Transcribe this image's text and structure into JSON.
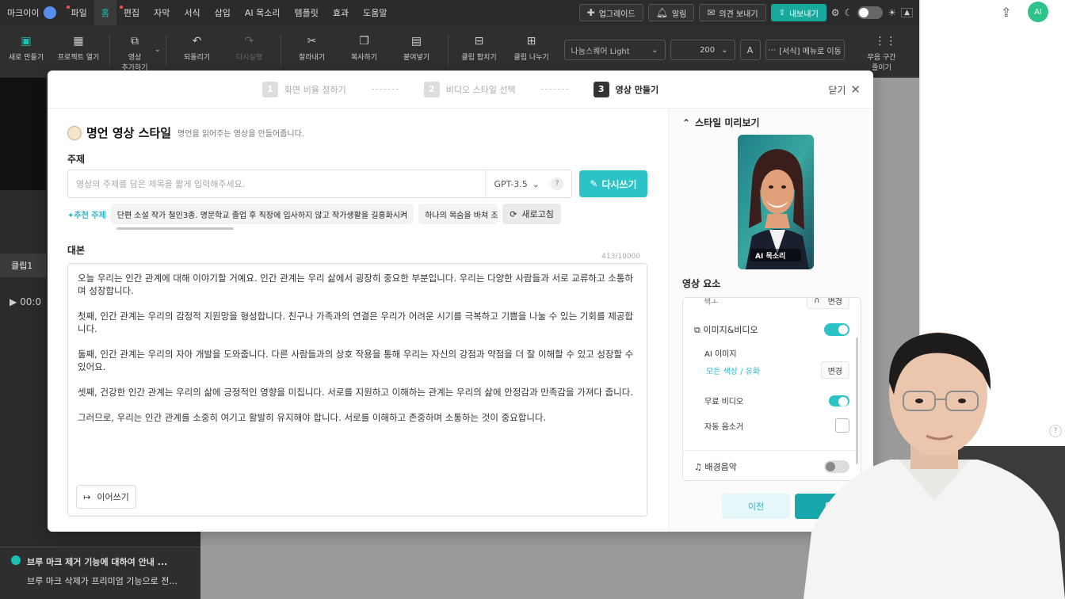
{
  "menubar": {
    "user": "마크이이",
    "items": [
      {
        "label": "파일",
        "dot": true
      },
      {
        "label": "홈",
        "active": true
      },
      {
        "label": "편집",
        "dot": true
      },
      {
        "label": "자막"
      },
      {
        "label": "서식"
      },
      {
        "label": "삽입"
      },
      {
        "label": "AI 목소리"
      },
      {
        "label": "템플릿"
      },
      {
        "label": "효과"
      },
      {
        "label": "도움말"
      }
    ],
    "upgrade": "업그레이드",
    "alert": "알림",
    "feedback": "의견 보내기",
    "export": "내보내기"
  },
  "toolbar": {
    "new": "새로 만들기",
    "open": "프로젝트 열기",
    "add_video_1": "영상",
    "add_video_2": "추가하기",
    "undo": "되돌리기",
    "redo": "다시실행",
    "cut": "잘라내기",
    "copy": "복사하기",
    "paste": "붙여넣기",
    "merge": "클립 합치기",
    "split": "클립 나누기",
    "font": "나눔스퀘어 Light",
    "size": "200",
    "format_btn": "A",
    "move_menu": "[서식] 메뉴로 이동",
    "silence_1": "무음 구간",
    "silence_2": "줄이기"
  },
  "leftpanel": {
    "time": "00:0",
    "clip": "클립1",
    "notice_title": "브루 마크 제거 기능에 대하여 안내 ...",
    "notice_body": "브루 마크 삭제가 프리미엄 기능으로 전..."
  },
  "modal": {
    "steps": [
      {
        "num": "1",
        "label": "화면 비율 정하기"
      },
      {
        "num": "2",
        "label": "비디오 스타일 선택"
      },
      {
        "num": "3",
        "label": "영상 만들기",
        "active": true
      }
    ],
    "close": "닫기",
    "style_name": "명언 영상 스타일",
    "style_desc": "명언을 읽어주는 영상을 만들어줍니다.",
    "topic_label": "주제",
    "topic_placeholder": "영상의 주제를 담은 제목을 짧게 입력해주세요.",
    "model": "GPT-3.5",
    "help": "?",
    "rewrite": "다시쓰기",
    "rec_label": "추천 주제",
    "rec_chips": [
      "단편 소설 작가 철인3종. 명문학교 졸업 후 직장에 입사하지 않고 작가생활을 길홍화시켜",
      "하나의 목숨을 바쳐 조"
    ],
    "refresh": "새로고침",
    "script_label": "대본",
    "counter": "413/10000",
    "script": [
      "오늘 우리는 인간 관계에 대해 이야기할 거예요. 인간 관계는 우리 삶에서 굉장히 중요한 부분입니다. 우리는 다양한 사람들과 서로 교류하고 소통하며 성장합니다.",
      "첫째, 인간 관계는 우리의 감정적 지원망을 형성합니다. 친구나 가족과의 연결은 우리가 어려운 시기를 극복하고 기쁨을 나눌 수 있는 기회를 제공합니다.",
      "둘째, 인간 관계는 우리의 자아 개발을 도와줍니다. 다른 사람들과의 상호 작용을 통해 우리는 자신의 강점과 약점을 더 잘 이해할 수 있고 성장할 수 있어요.",
      "셋째, 건강한 인간 관계는 우리의 삶에 긍정적인 영향을 미칩니다. 서로를 지원하고 이해하는 관계는 우리의 삶에 안정감과 만족감을 가져다 줍니다.",
      "그러므로, 우리는 인간 관계를 소중히 여기고 활발히 유지해야 합니다. 서로를 이해하고 존중하며 소통하는 것이 중요합니다."
    ],
    "continue": "이어쓰기",
    "preview_title": "스타일 미리보기",
    "preview_badge": "AI 목소리",
    "elements_title": "영상 요소",
    "partial_left": "색ㅗ",
    "partial_right": "변경",
    "image_video": "이미지&비디오",
    "ai_image": "AI 이미지",
    "ai_image_value": "모든 색상 / 유화",
    "change": "변경",
    "free_video": "무료 비디오",
    "auto_silence": "자동 음소거",
    "bgm": "배경음악",
    "prev": "이전",
    "make": "완"
  },
  "rightpanel": {
    "avatar": "AI",
    "help": "?"
  },
  "colors": {
    "accent": "#2cc3c7",
    "accent_dark": "#18a6ad",
    "menubar_bg": "#2b2b2b"
  }
}
